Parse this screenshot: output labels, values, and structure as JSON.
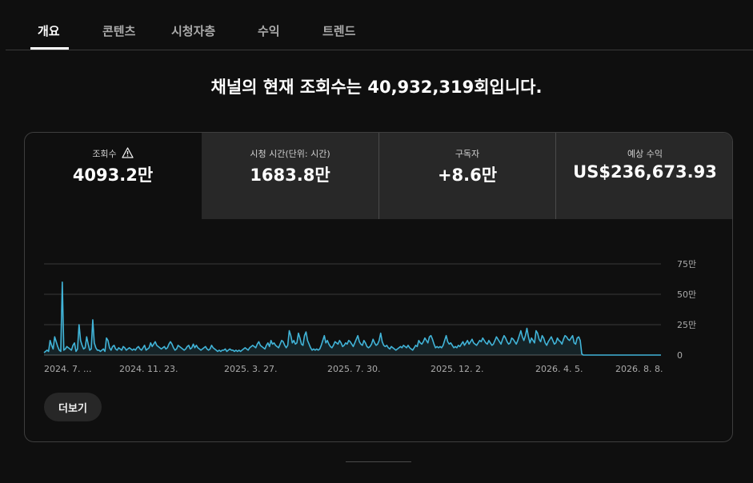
{
  "tabs": [
    {
      "label": "개요"
    },
    {
      "label": "콘텐츠"
    },
    {
      "label": "시청자층"
    },
    {
      "label": "수익"
    },
    {
      "label": "트렌드"
    }
  ],
  "headline": "채널의 현재 조회수는 40,932,319회입니다.",
  "metrics": [
    {
      "label": "조회수",
      "value": "4093.2만",
      "icon": "warning-icon"
    },
    {
      "label": "시청 시간(단위: 시간)",
      "value": "1683.8만"
    },
    {
      "label": "구독자",
      "value": "+8.6만"
    },
    {
      "label": "예상 수익",
      "value": "US$236,673.93"
    }
  ],
  "more_button": {
    "label": "더보기"
  },
  "colors": {
    "accent": "#41b4d8",
    "background": "#0f0f0f",
    "card_inactive": "#282828"
  },
  "chart_data": {
    "type": "line",
    "series": [
      {
        "values": [
          2,
          3,
          4,
          3,
          12,
          8,
          5,
          15,
          11,
          7,
          4,
          3,
          60,
          4,
          5,
          7,
          6,
          5,
          4,
          8,
          10,
          3,
          5,
          25,
          12,
          8,
          5,
          6,
          15,
          9,
          4,
          5,
          29,
          10,
          6,
          4,
          4,
          3,
          4,
          5,
          3,
          14,
          12,
          6,
          4,
          7,
          8,
          5,
          4,
          6,
          5,
          4,
          7,
          6,
          4,
          5,
          6,
          5,
          4,
          5,
          4,
          6,
          7,
          5,
          4,
          6,
          8,
          4,
          5,
          6,
          10,
          7,
          9,
          11,
          8,
          7,
          6,
          5,
          6,
          7,
          5,
          6,
          9,
          11,
          9,
          6,
          4,
          5,
          8,
          7,
          6,
          5,
          4,
          5,
          7,
          8,
          5,
          6,
          9,
          6,
          8,
          6,
          5,
          4,
          5,
          6,
          7,
          5,
          4,
          5,
          8,
          6,
          5,
          4,
          3,
          4,
          3,
          4,
          4,
          5,
          3,
          4,
          5,
          4,
          4,
          3,
          4,
          3,
          4,
          3,
          4,
          5,
          6,
          5,
          4,
          6,
          7,
          8,
          7,
          6,
          9,
          11,
          8,
          7,
          6,
          5,
          8,
          10,
          7,
          12,
          9,
          10,
          8,
          7,
          6,
          9,
          12,
          11,
          8,
          6,
          8,
          20,
          16,
          10,
          12,
          9,
          10,
          18,
          14,
          9,
          8,
          16,
          19,
          12,
          9,
          6,
          4,
          5,
          4,
          5,
          4,
          5,
          8,
          12,
          16,
          10,
          12,
          9,
          7,
          6,
          8,
          11,
          10,
          9,
          12,
          10,
          7,
          8,
          10,
          9,
          12,
          11,
          9,
          7,
          10,
          13,
          16,
          11,
          9,
          8,
          12,
          10,
          7,
          6,
          7,
          9,
          13,
          10,
          8,
          9,
          12,
          18,
          11,
          8,
          7,
          8,
          6,
          5,
          7,
          6,
          5,
          4,
          5,
          6,
          7,
          6,
          8,
          7,
          6,
          8,
          6,
          5,
          4,
          6,
          8,
          7,
          12,
          10,
          9,
          11,
          14,
          12,
          10,
          15,
          16,
          13,
          9,
          6,
          7,
          6,
          7,
          6,
          8,
          12,
          16,
          11,
          9,
          10,
          8,
          6,
          7,
          6,
          8,
          7,
          9,
          11,
          8,
          10,
          12,
          9,
          11,
          13,
          10,
          9,
          8,
          10,
          12,
          11,
          14,
          12,
          10,
          9,
          12,
          10,
          8,
          9,
          12,
          15,
          13,
          11,
          9,
          13,
          16,
          14,
          11,
          9,
          10,
          14,
          13,
          11,
          9,
          12,
          16,
          20,
          15,
          12,
          16,
          22,
          15,
          10,
          14,
          12,
          10,
          20,
          18,
          13,
          11,
          16,
          14,
          10,
          8,
          11,
          13,
          15,
          12,
          9,
          10,
          14,
          12,
          11,
          9,
          13,
          16,
          15,
          13,
          12,
          14,
          16,
          10,
          9,
          14,
          15,
          12,
          1,
          0,
          0,
          0,
          0,
          0,
          0,
          0,
          0,
          0,
          0,
          0,
          0,
          0,
          0,
          0,
          0,
          0,
          0,
          0,
          0,
          0,
          0,
          0,
          0,
          0,
          0,
          0,
          0,
          0,
          0,
          0,
          0,
          0,
          0,
          0,
          0,
          0,
          0,
          0,
          0,
          0,
          0,
          0,
          0,
          0,
          0,
          0,
          0,
          0,
          0,
          0,
          0
        ]
      }
    ],
    "x_tick_labels": [
      "2024. 7. ...",
      "2024. 11. 23.",
      "2025. 3. 27.",
      "2025. 7. 30.",
      "2025. 12. 2.",
      "2026. 4. 5.",
      "2026. 8. 8."
    ],
    "y_tick_labels": [
      "0",
      "25만",
      "50만",
      "75만"
    ],
    "ylim": [
      0,
      75
    ],
    "y_unit": "만",
    "grid": true
  }
}
